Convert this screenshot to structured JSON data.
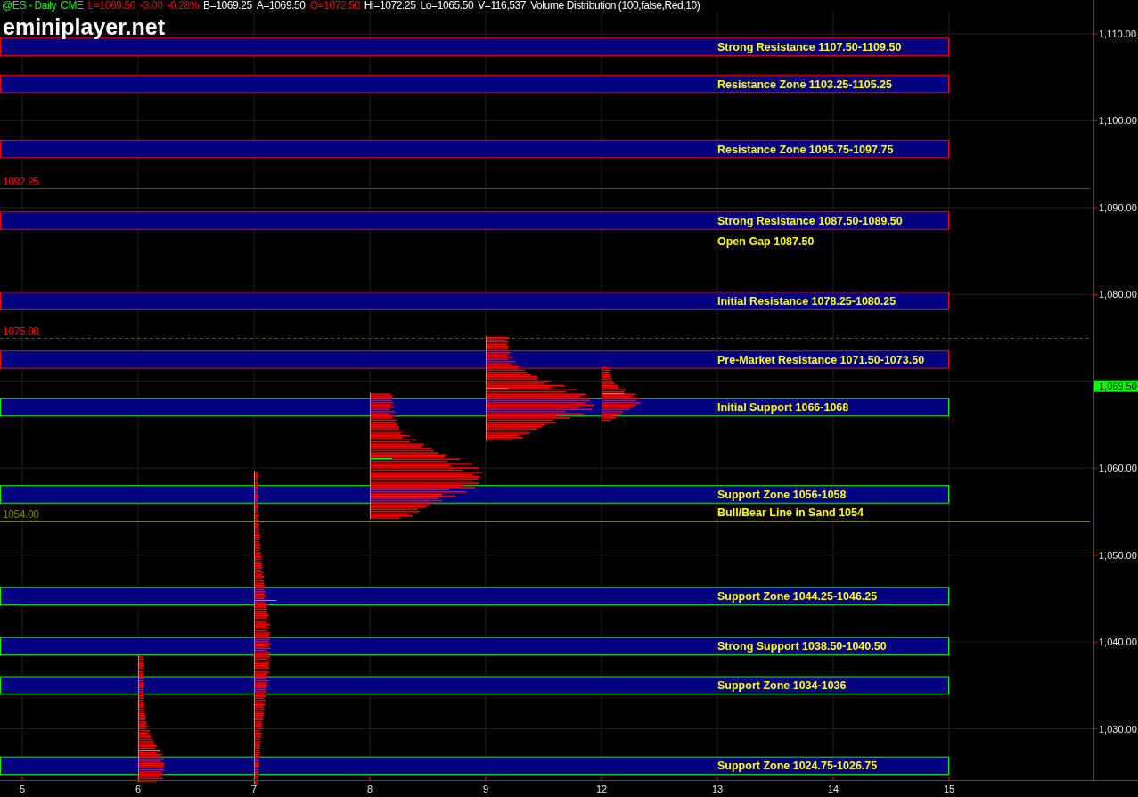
{
  "header": {
    "items": [
      {
        "text": "@ES - Daily",
        "color": "#00ff00"
      },
      {
        "text": "CME",
        "color": "#00ff00"
      },
      {
        "text": "L=1069.50",
        "color": "#ff0000"
      },
      {
        "text": "-3.00",
        "color": "#ff0000"
      },
      {
        "text": "-0.28%",
        "color": "#ff0000"
      },
      {
        "text": "B=1069.25",
        "color": "#ffffff"
      },
      {
        "text": "A=1069.50",
        "color": "#ffffff"
      },
      {
        "text": "O=1072.50",
        "color": "#ff0000"
      },
      {
        "text": "Hi=1072.25",
        "color": "#ffffff"
      },
      {
        "text": "Lo=1065.50",
        "color": "#ffffff"
      },
      {
        "text": "V=116,537",
        "color": "#ffffff"
      },
      {
        "text": "Volume Distribution (100,false,Red,10)",
        "color": "#ffffff"
      }
    ]
  },
  "logo": {
    "text": "eminiplayer.net"
  },
  "chart": {
    "price_axis": [
      "1,110.00",
      "1,100.00",
      "1,090.00",
      "1,080.00",
      "1,060.00",
      "1,050.00",
      "1,040.00",
      "1,030.00"
    ],
    "current_price": "1,069.50",
    "date_axis": [
      "5",
      "6",
      "7",
      "8",
      "9",
      "12",
      "13",
      "14",
      "15"
    ],
    "zones": [
      {
        "label": "Strong Resistance 1107.50-1109.50",
        "color": "#ff0000"
      },
      {
        "label": "Resistance Zone 1103.25-1105.25",
        "color": "#ff0000"
      },
      {
        "label": "Resistance Zone 1095.75-1097.75",
        "color": "#ff0000"
      },
      {
        "label": "Strong Resistance 1087.50-1089.50",
        "color": "#ff0000"
      },
      {
        "label": "Initial Resistance 1078.25-1080.25",
        "color": "#ff0000"
      },
      {
        "label": "Pre-Market Resistance 1071.50-1073.50",
        "color": "#ff0000"
      },
      {
        "label": "Initial Support 1066-1068",
        "color": "#00ff00"
      },
      {
        "label": "Support Zone 1056-1058",
        "color": "#00ff00"
      },
      {
        "label": "Support Zone 1044.25-1046.25",
        "color": "#00ff00"
      },
      {
        "label": "Strong Support 1038.50-1040.50",
        "color": "#00ff00"
      },
      {
        "label": "Support Zone 1034-1036",
        "color": "#00ff00"
      },
      {
        "label": "Support Zone 1024.75-1026.75",
        "color": "#00ff00"
      }
    ],
    "price_lines": [
      {
        "label": "1092.25",
        "color": "#ff0000"
      },
      {
        "label": "1075.00",
        "color": "#ff0000"
      },
      {
        "label": "1054.00",
        "color": "#808000"
      }
    ],
    "notes": [
      "Open Gap 1087.50",
      "Bull/Bear Line in Sand 1054"
    ]
  }
}
